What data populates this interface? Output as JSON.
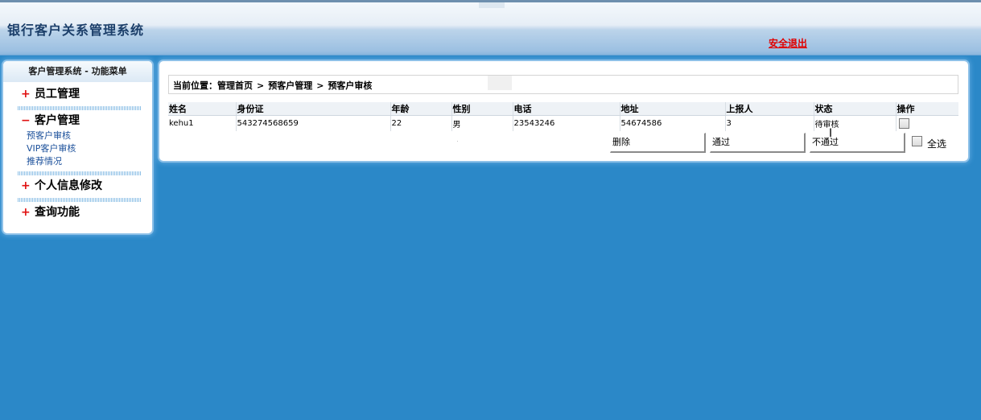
{
  "header": {
    "title": "银行客户关系管理系统",
    "logout": "安全退出"
  },
  "sidebar": {
    "title": "客户管理系统 - 功能菜单",
    "groups": [
      {
        "sign": "+",
        "label": "员工管理",
        "expanded": false
      },
      {
        "sign": "−",
        "label": "客户管理",
        "expanded": true,
        "items": [
          "预客户审核",
          "VIP客户审核",
          "推荐情况"
        ]
      },
      {
        "sign": "+",
        "label": "个人信息修改",
        "expanded": false
      },
      {
        "sign": "+",
        "label": "查询功能",
        "expanded": false
      }
    ]
  },
  "breadcrumb": {
    "prefix": "当前位置：",
    "crumbs": [
      "管理首页",
      "预客户管理",
      "预客户审核"
    ],
    "separator": ">"
  },
  "table": {
    "columns": [
      "姓名",
      "身份证",
      "年龄",
      "性别",
      "电话",
      "地址",
      "上报人",
      "状态",
      "操作"
    ],
    "rows": [
      {
        "name": "kehu1",
        "idcard": "543274568659",
        "age": "22",
        "gender": "男",
        "phone": "23543246",
        "address": "54674586",
        "reporter": "3",
        "status": "待审核",
        "selected": false
      }
    ]
  },
  "actions": {
    "delete": "删除",
    "approve": "通过",
    "reject": "不通过",
    "select_all": "全选"
  },
  "colors": {
    "background": "#2b88c8",
    "logout": "#e00000",
    "menu_sign": "#e01010",
    "sub_item": "#1a4f9a"
  }
}
